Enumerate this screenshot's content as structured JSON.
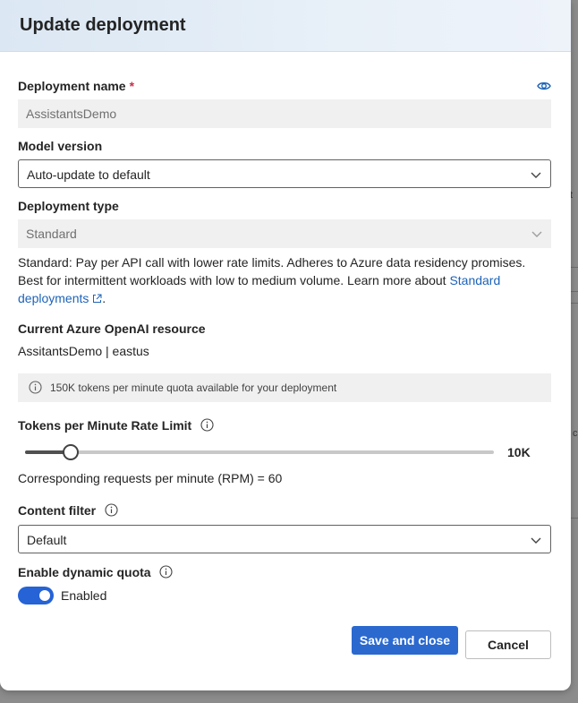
{
  "dialog": {
    "title": "Update deployment"
  },
  "background": {
    "glyph_a": "t",
    "glyph_b": "c"
  },
  "deployment_name": {
    "label": "Deployment name",
    "required_mark": "*",
    "value": "AssistantsDemo"
  },
  "model_version": {
    "label": "Model version",
    "selected": "Auto-update to default"
  },
  "deployment_type": {
    "label": "Deployment type",
    "selected": "Standard",
    "description": "Standard: Pay per API call with lower rate limits. Adheres to Azure data residency promises. Best for intermittent workloads with low to medium volume. Learn more about ",
    "link_text": "Standard deployments",
    "after_link": "."
  },
  "resource": {
    "label": "Current Azure OpenAI resource",
    "value": "AssitantsDemo | eastus"
  },
  "quota_info": {
    "text": "150K tokens per minute quota available for your deployment"
  },
  "rate_limit": {
    "label": "Tokens per Minute Rate Limit",
    "value_label": "10K",
    "value_fraction": 0.06,
    "rpm_text": "Corresponding requests per minute (RPM) = 60"
  },
  "content_filter": {
    "label": "Content filter",
    "selected": "Default"
  },
  "dynamic_quota": {
    "label": "Enable dynamic quota",
    "state_label": "Enabled",
    "enabled": true
  },
  "actions": {
    "save_label": "Save and close",
    "cancel_label": "Cancel"
  },
  "colors": {
    "accent": "#2b69cf",
    "link": "#1d63b8",
    "required": "#c4314b"
  }
}
